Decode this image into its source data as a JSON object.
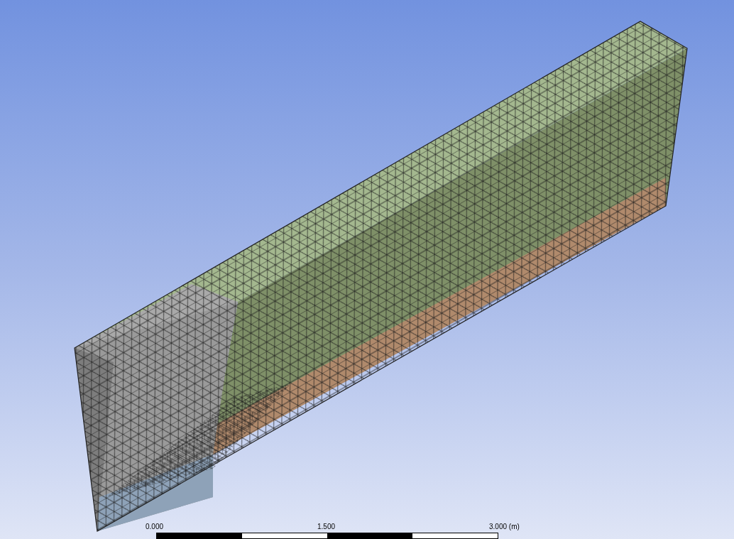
{
  "scale_bar": {
    "labels": [
      "0.000",
      "1.500",
      "3.000 (m)"
    ]
  }
}
